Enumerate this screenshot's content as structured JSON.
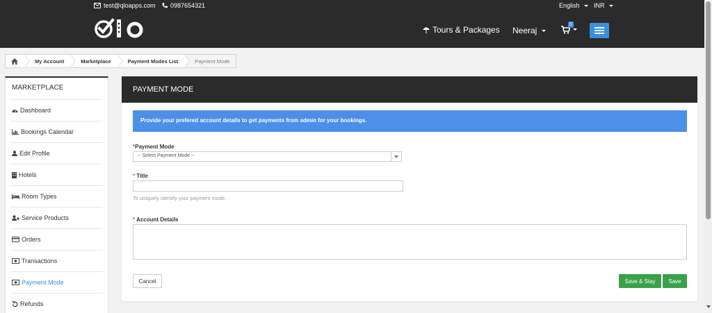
{
  "topbar": {
    "email": "test@qloapps.com",
    "phone": "0987654321",
    "language": "English",
    "currency": "INR"
  },
  "header": {
    "logo": "qlo",
    "tours_label": "Tours & Packages",
    "user_name": "Neeraj",
    "cart_count": "0"
  },
  "breadcrumb": [
    "My Account",
    "Marketplace",
    "Payment Modes List",
    "Payment Mode"
  ],
  "sidebar": {
    "title": "MARKETPLACE",
    "items": [
      {
        "label": "Dashboard",
        "icon": "dashboard-icon"
      },
      {
        "label": "Bookings Calendar",
        "icon": "bar-chart-icon"
      },
      {
        "label": "Edit Profile",
        "icon": "user-icon"
      },
      {
        "label": "Hotels",
        "icon": "building-icon"
      },
      {
        "label": "Room Types",
        "icon": "bed-icon"
      },
      {
        "label": "Service Products",
        "icon": "user-plus-icon"
      },
      {
        "label": "Orders",
        "icon": "credit-card-icon"
      },
      {
        "label": "Transactions",
        "icon": "money-icon"
      },
      {
        "label": "Payment Mode",
        "icon": "money-icon",
        "active": true
      },
      {
        "label": "Refunds",
        "icon": "undo-icon"
      }
    ]
  },
  "panel": {
    "title": "PAYMENT MODE",
    "alert": "Provide your prefered account details to get payments from admin for your bookings.",
    "payment_mode_label": "Payment Mode",
    "payment_mode_value": "-- Select Payment Mode --",
    "title_label": "Title",
    "title_hint": "To uniquely identify your payment mode.",
    "account_label": "Account Details",
    "cancel_label": "Cancel",
    "save_stay_label": "Save & Stay",
    "save_label": "Save"
  },
  "colors": {
    "dark": "#2b2b2b",
    "accent_blue": "#3b8fe0",
    "alert_blue": "#4b8fe8",
    "save_green": "#3aa04a",
    "required_red": "#d9534f"
  }
}
